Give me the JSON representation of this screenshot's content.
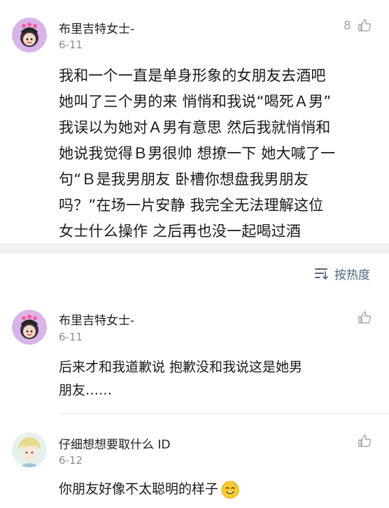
{
  "post": {
    "username": "布里吉特女士-",
    "date": "6-11",
    "like_count": "8",
    "body": "我和一个一直是单身形象的女朋友去酒吧\n她叫了三个男的来 悄悄和我说“喝死Ａ男”\n我误以为她对Ａ男有意思 然后我就悄悄和\n她说我觉得Ｂ男很帅 想撩一下 她大喊了一\n句“Ｂ是我男朋友 卧槽你想盘我男朋友\n吗？”在场一片安静 我完全无法理解这位\n女士什么操作 之后再也没一起喝过酒"
  },
  "sort": {
    "label": "按热度",
    "icon": "sort-icon"
  },
  "comments": [
    {
      "username": "布里吉特女士-",
      "date": "6-11",
      "body": "后来才和我道歉说 抱歉没和我说这是她男\n朋友……"
    },
    {
      "username": "仔细想想要取什么 ID",
      "date": "6-12",
      "body": "你朋友好像不太聪明的样子",
      "emoji": "sweat-smile-emoji"
    }
  ],
  "colors": {
    "accent": "#52657d",
    "muted": "#8c8c8c",
    "band": "#f2f2f2"
  }
}
